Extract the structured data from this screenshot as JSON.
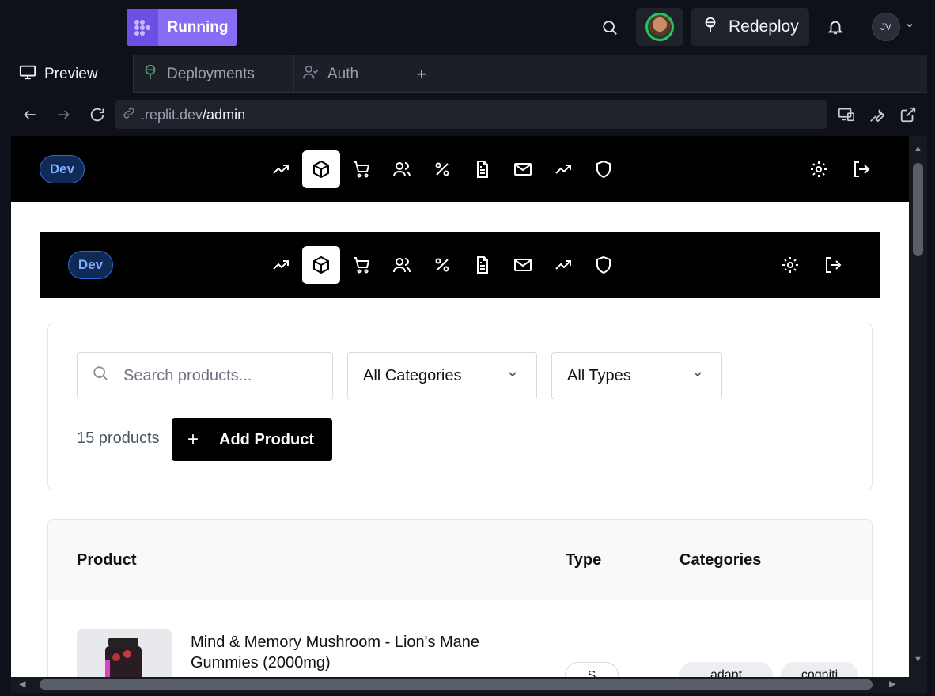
{
  "topbar": {
    "status_label": "Running",
    "redeploy_label": "Redeploy",
    "user_initials": "JV"
  },
  "tabs": [
    {
      "label": "Preview",
      "icon": "monitor-icon",
      "active": true
    },
    {
      "label": "Deployments",
      "icon": "deployments-icon",
      "active": false
    },
    {
      "label": "Auth",
      "icon": "user-check-icon",
      "active": false
    }
  ],
  "address": {
    "domain": ".replit.dev",
    "path": "/admin"
  },
  "admin_nav": {
    "env_badge": "Dev",
    "items": [
      "trending-icon",
      "package-icon",
      "cart-icon",
      "users-icon",
      "percent-icon",
      "file-icon",
      "mail-icon",
      "trending-icon",
      "shield-icon"
    ],
    "active_index": 1
  },
  "filters": {
    "search_placeholder": "Search products...",
    "category_value": "All Categories",
    "type_value": "All Types",
    "count_text": "15 products",
    "add_button_label": "Add Product"
  },
  "table": {
    "headers": {
      "product": "Product",
      "type": "Type",
      "categories": "Categories"
    },
    "rows": [
      {
        "title": "Mind & Memory Mushroom - Lion's Mane Gummies (2000mg)",
        "type": "S",
        "categories": [
          "adapt",
          "cogniti"
        ]
      }
    ]
  },
  "colors": {
    "accent": "#7b5cf0",
    "dev_badge": "#2f6bd6",
    "status_ring": "#22c55e"
  }
}
